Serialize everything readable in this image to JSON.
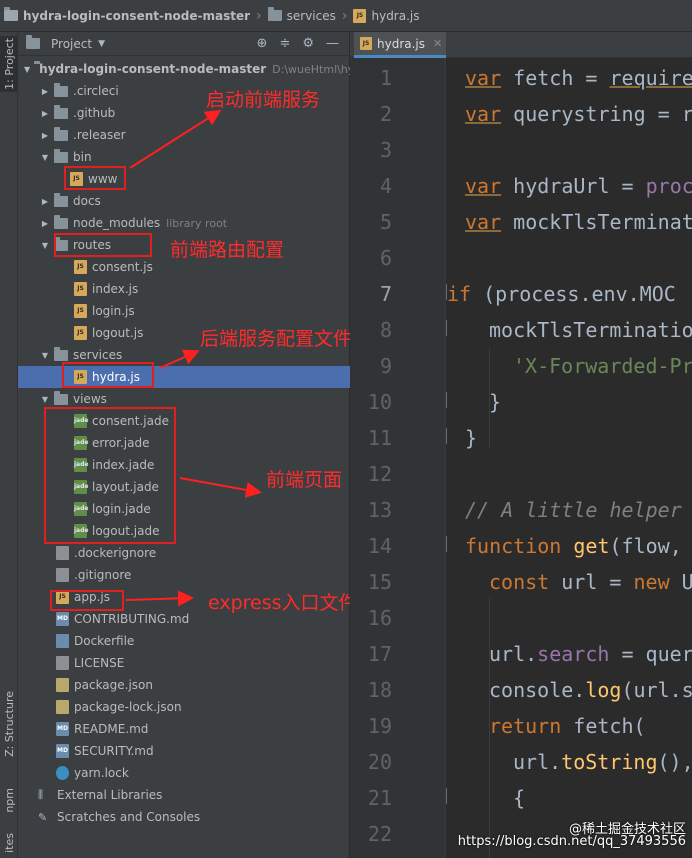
{
  "breadcrumb": {
    "project": "hydra-login-consent-node-master",
    "folder": "services",
    "file": "hydra.js"
  },
  "toolstrip": {
    "project_tab": "1: Project",
    "structure_tab": "Z: Structure",
    "npm_tab": "npm",
    "favorites_tab": "ites"
  },
  "panel": {
    "title": "Project",
    "header_icons": [
      "target-icon",
      "collapse-icon",
      "gear-icon",
      "hide-icon"
    ]
  },
  "tree": {
    "root_name": "hydra-login-consent-node-master",
    "root_path": "D:\\wueHtml\\hydra-",
    "circleci": ".circleci",
    "github": ".github",
    "releaser": ".releaser",
    "bin": "bin",
    "www": "www",
    "docs": "docs",
    "node_modules": "node_modules",
    "library_root": "library root",
    "routes": "routes",
    "consent_js": "consent.js",
    "index_js": "index.js",
    "login_js": "login.js",
    "logout_js": "logout.js",
    "services": "services",
    "hydra_js": "hydra.js",
    "views": "views",
    "consent_jade": "consent.jade",
    "error_jade": "error.jade",
    "index_jade": "index.jade",
    "layout_jade": "layout.jade",
    "login_jade": "login.jade",
    "logout_jade": "logout.jade",
    "dockerignore": ".dockerignore",
    "gitignore": ".gitignore",
    "app_js": "app.js",
    "contributing": "CONTRIBUTING.md",
    "dockerfile": "Dockerfile",
    "license": "LICENSE",
    "package_json": "package.json",
    "package_lock": "package-lock.json",
    "readme": "README.md",
    "security": "SECURITY.md",
    "yarn_lock": "yarn.lock",
    "external_libraries": "External Libraries",
    "scratches": "Scratches and Consoles"
  },
  "annotations": {
    "bin": "启动前端服务",
    "routes": "前端路由配置",
    "services": "后端服务配置文件",
    "views": "前端页面",
    "app": "express入口文件"
  },
  "editor": {
    "tab_label": "hydra.js",
    "tab_badge": "JS",
    "line_numbers": [
      "1",
      "2",
      "3",
      "4",
      "5",
      "6",
      "7",
      "8",
      "9",
      "10",
      "11",
      "12",
      "13",
      "14",
      "15",
      "16",
      "17",
      "18",
      "19",
      "20",
      "21",
      "22"
    ],
    "current_line": "7",
    "lines": {
      "l1_kw": "var",
      "l1_rest": " fetch = ",
      "l1_fn": "require",
      "l2_kw": "var",
      "l2_rest": " querystring = r",
      "l4_kw": "var",
      "l4_rest": " hydraUrl = ",
      "l4_tail": "proc",
      "l5_kw": "var",
      "l5_rest": " mockTlsTerminat",
      "l7_kw": "if",
      "l7_rest": " (process.env.MOC",
      "l8_rest": "mockTlsTerminatio",
      "l9_str": "'X-Forwarded-Pr",
      "l10_rest": "}",
      "l11_rest": "}",
      "l13_cm": "// A little helper",
      "l14_kw": "function",
      "l14_fn": " get",
      "l14_rest": "(flow,",
      "l15_kw": "const",
      "l15_rest": " url = ",
      "l15_kw2": "new",
      "l15_tail": " U",
      "l17_a": "url.",
      "l17_prop": "search",
      "l17_b": " = quer",
      "l18_a": "console.",
      "l18_fn": "log",
      "l18_b": "(url.s",
      "l19_kw": "return",
      "l19_rest": " fetch(",
      "l20_a": "url.",
      "l20_fn": "toString",
      "l20_b": "(),",
      "l21_rest": "{",
      "l22_rest": "''"
    }
  },
  "watermark": {
    "line1": "@稀土掘金技术社区",
    "line2": "https://blog.csdn.net/qq_37493556"
  }
}
